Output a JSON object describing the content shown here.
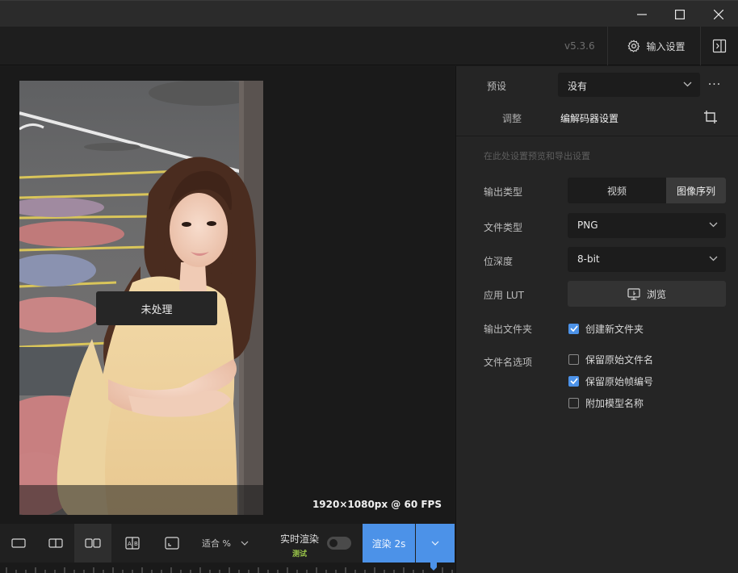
{
  "window": {
    "minimize_icon": "minimize-icon",
    "maximize_icon": "maximize-icon",
    "close_icon": "close-icon"
  },
  "toolbar": {
    "version": "v5.3.6",
    "input_settings_label": "输入设置",
    "input_settings_icon": "gear-icon",
    "panel_toggle_icon": "panel-toggle-icon"
  },
  "preview": {
    "overlay_label": "未处理",
    "resolution_text": "1920×1080px @ 60 FPS"
  },
  "bottom": {
    "view_modes": [
      "single-view",
      "split-view",
      "side-by-side-view",
      "compare-view",
      "fit-screen-view"
    ],
    "active_view_mode": "side-by-side-view",
    "fit_label": "适合 %",
    "realtime_label": "实时渲染",
    "realtime_badge": "测试",
    "realtime_on": false,
    "render_label": "渲染 2s"
  },
  "panel": {
    "preset_label": "预设",
    "preset_value": "没有",
    "more_label": "···",
    "tabs": [
      {
        "label": "调整",
        "active": false
      },
      {
        "label": "编解码器设置",
        "active": true
      }
    ],
    "hint": "在此处设置预览和导出设置",
    "output_type_label": "输出类型",
    "output_type_options": [
      "视频",
      "图像序列"
    ],
    "output_type_selected": "图像序列",
    "file_type_label": "文件类型",
    "file_type_value": "PNG",
    "bit_depth_label": "位深度",
    "bit_depth_value": "8-bit",
    "lut_label": "应用 LUT",
    "browse_label": "浏览",
    "output_folder_label": "输出文件夹",
    "create_folder_label": "创建新文件夹",
    "create_folder_checked": true,
    "filename_options_label": "文件名选项",
    "filename_options": [
      {
        "label": "保留原始文件名",
        "checked": false
      },
      {
        "label": "保留原始帧编号",
        "checked": true
      },
      {
        "label": "附加模型名称",
        "checked": false
      }
    ]
  },
  "colors": {
    "accent": "#4c92e8",
    "badge_green": "#9ac54a",
    "panel_bg": "#252525"
  }
}
